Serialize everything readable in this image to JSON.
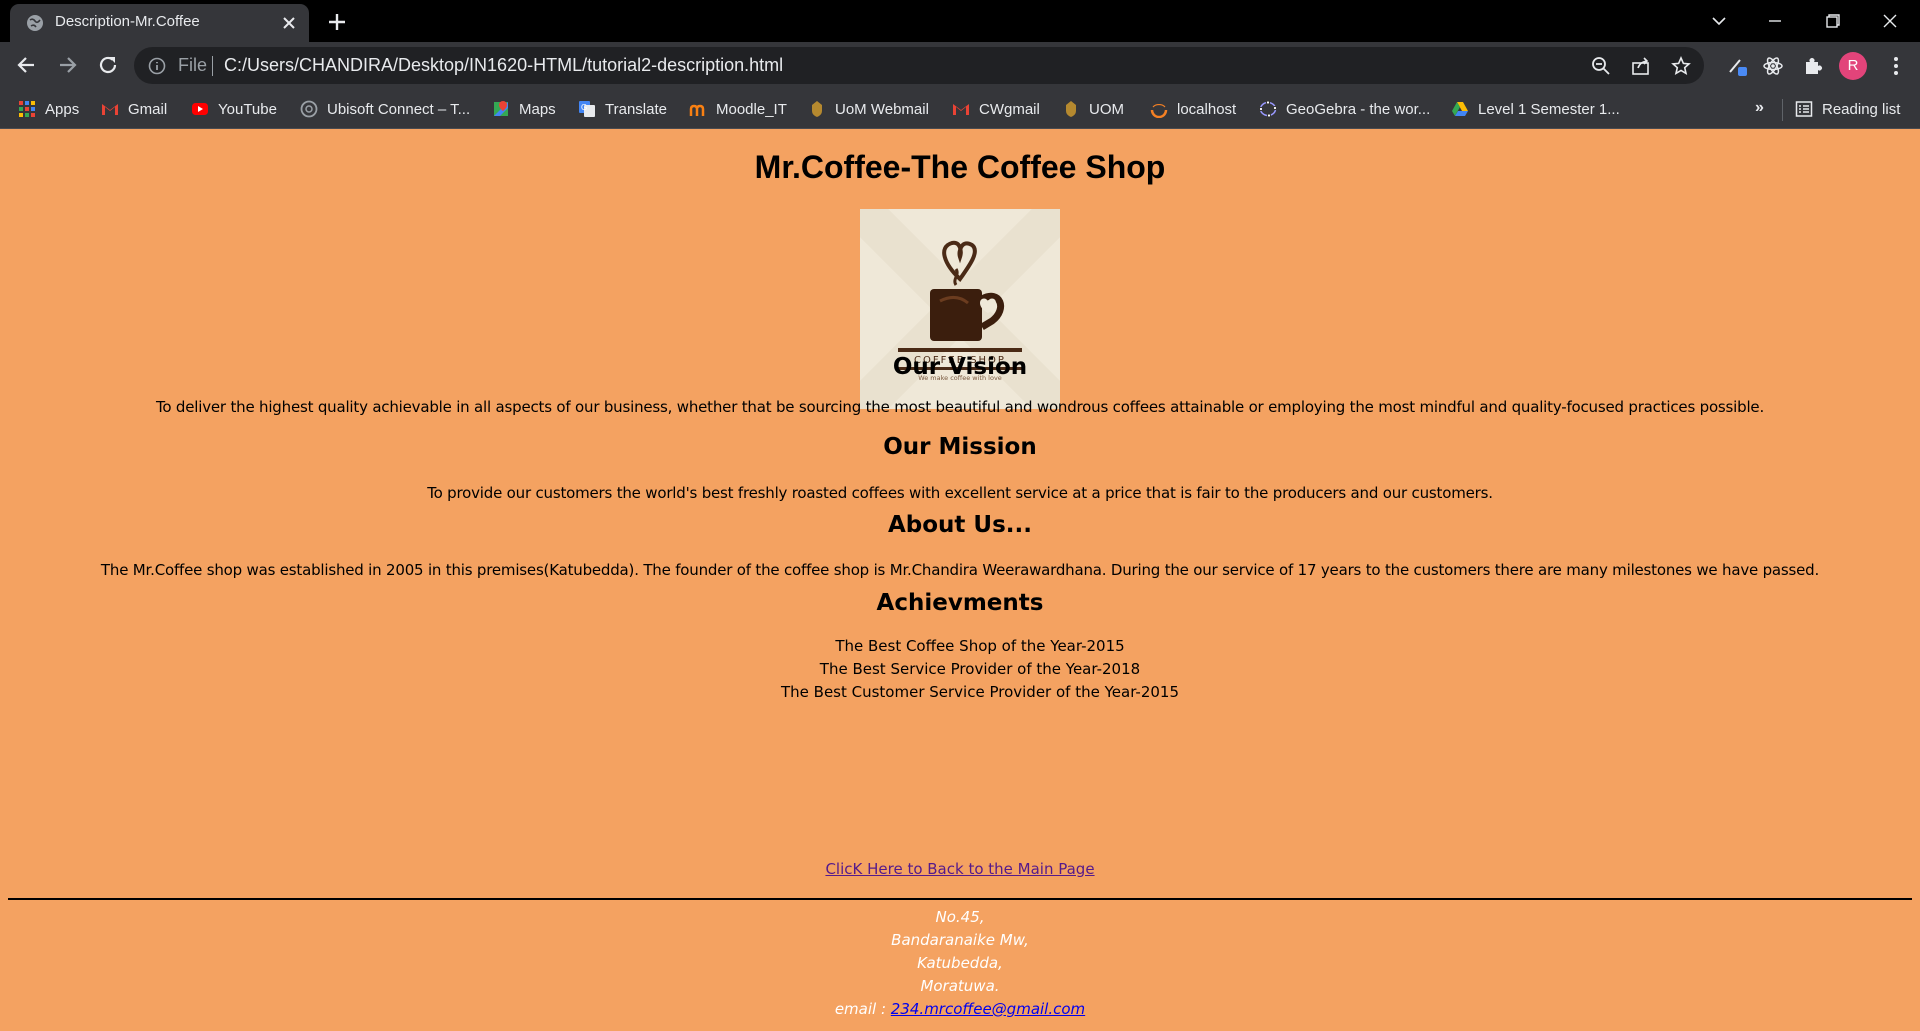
{
  "browser": {
    "tab": {
      "title": "Description-Mr.Coffee"
    },
    "address_bar": {
      "scheme_label": "File",
      "url": "C:/Users/CHANDIRA/Desktop/IN1620-HTML/tutorial2-description.html"
    },
    "profile_initial": "R",
    "bookmarks": [
      {
        "label": "Apps",
        "icon": "apps-grid-icon"
      },
      {
        "label": "Gmail",
        "icon": "gmail-icon"
      },
      {
        "label": "YouTube",
        "icon": "youtube-icon"
      },
      {
        "label": "Ubisoft Connect – T...",
        "icon": "ubisoft-icon"
      },
      {
        "label": "Maps",
        "icon": "maps-icon"
      },
      {
        "label": "Translate",
        "icon": "translate-icon"
      },
      {
        "label": "Moodle_IT",
        "icon": "moodle-icon"
      },
      {
        "label": "UoM Webmail",
        "icon": "uom-icon"
      },
      {
        "label": "CWgmail",
        "icon": "gmail-icon"
      },
      {
        "label": "UOM",
        "icon": "uom-icon"
      },
      {
        "label": "localhost",
        "icon": "localhost-icon"
      },
      {
        "label": "GeoGebra - the wor...",
        "icon": "geogebra-icon"
      },
      {
        "label": "Level 1 Semester 1...",
        "icon": "google-drive-icon"
      }
    ],
    "bookmarks_overflow": "»",
    "reading_list": "Reading list"
  },
  "page": {
    "title": "Mr.Coffee-The Coffee Shop",
    "logo": {
      "text": "COFFEE SHOP",
      "tagline": "We make coffee with love"
    },
    "vision": {
      "heading": "Our Vision",
      "text": "To deliver the highest quality achievable in all aspects of our business, whether that be sourcing the most beautiful and wondrous coffees attainable or employing the most mindful and quality-focused practices possible."
    },
    "mission": {
      "heading": "Our Mission",
      "text": "To provide our customers the world's best freshly roasted coffees with excellent service at a price that is fair to the producers and our customers."
    },
    "about": {
      "heading": "About Us...",
      "text": "The Mr.Coffee shop was established in 2005 in this premises(Katubedda). The founder of the coffee shop is Mr.Chandira Weerawardhana. During the our service of 17 years to the customers there are many milestones we have passed."
    },
    "achievements": {
      "heading": "Achievments",
      "items": [
        "The Best Coffee Shop of the Year-2015",
        "The Best Service Provider of the Year-2018",
        "The Best Customer Service Provider of the Year-2015"
      ]
    },
    "back_link": "ClicK Here to Back to the Main Page",
    "address": {
      "line1": "No.45,",
      "line2": "Bandaranaike Mw,",
      "line3": "Katubedda,",
      "line4": "Moratuwa.",
      "email_label": "email : ",
      "email": "234.mrcoffee@gmail.com"
    }
  },
  "colors": {
    "page_background": "#f4a261",
    "link_visited": "#551a8b",
    "link": "#0000ee"
  }
}
